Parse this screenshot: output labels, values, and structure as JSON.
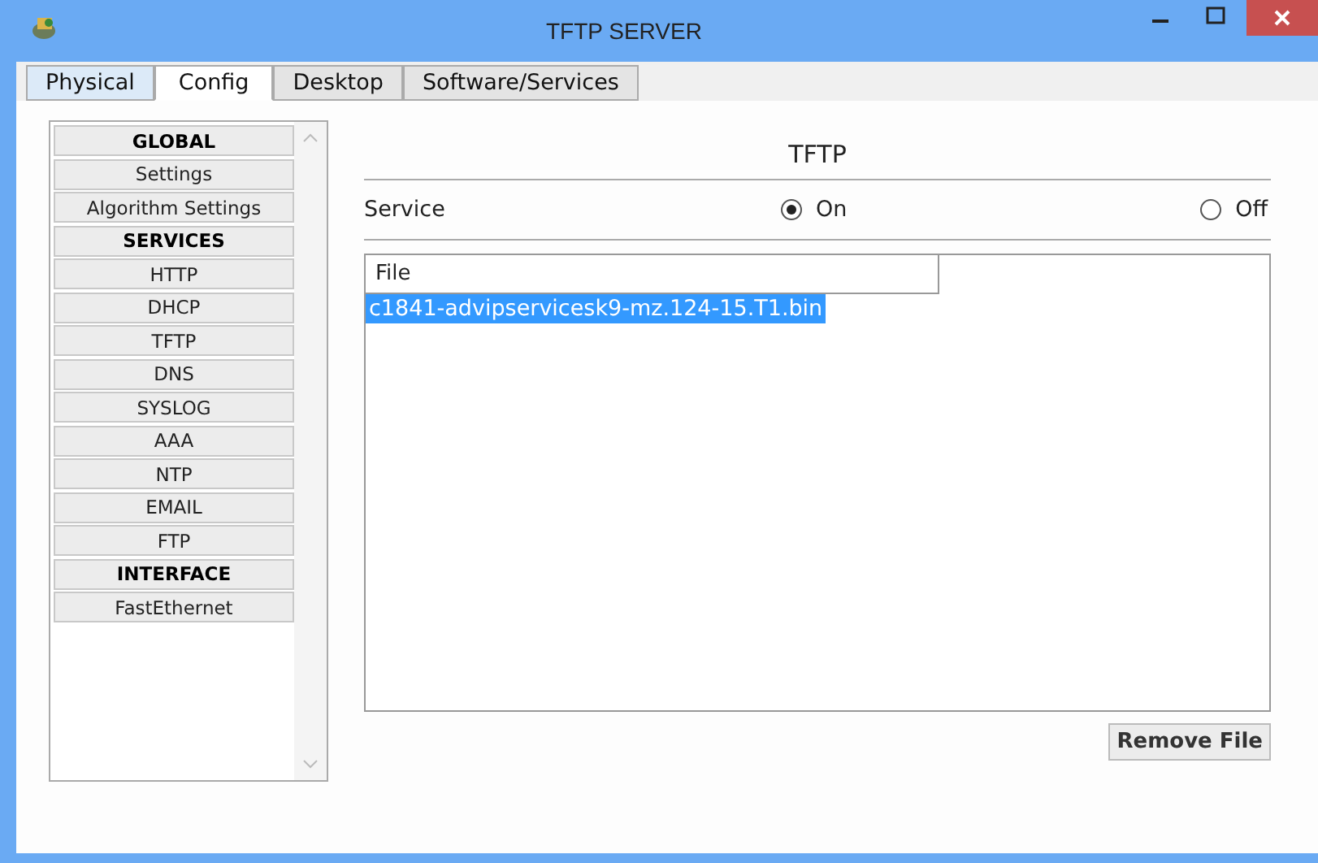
{
  "window": {
    "title": "TFTP SERVER"
  },
  "tabs": [
    {
      "label": "Physical",
      "selected": false
    },
    {
      "label": "Config",
      "selected": true
    },
    {
      "label": "Desktop",
      "selected": false
    },
    {
      "label": "Software/Services",
      "selected": false
    }
  ],
  "sidebar": {
    "items": [
      {
        "label": "GLOBAL",
        "kind": "header",
        "selected": false
      },
      {
        "label": "Settings",
        "kind": "item",
        "selected": false
      },
      {
        "label": "Algorithm Settings",
        "kind": "item",
        "selected": false
      },
      {
        "label": "SERVICES",
        "kind": "header",
        "selected": false
      },
      {
        "label": "HTTP",
        "kind": "item",
        "selected": false
      },
      {
        "label": "DHCP",
        "kind": "item",
        "selected": false
      },
      {
        "label": "TFTP",
        "kind": "item",
        "selected": false
      },
      {
        "label": "DNS",
        "kind": "item",
        "selected": false
      },
      {
        "label": "SYSLOG",
        "kind": "item",
        "selected": false
      },
      {
        "label": "AAA",
        "kind": "item",
        "selected": false
      },
      {
        "label": "NTP",
        "kind": "item",
        "selected": false
      },
      {
        "label": "EMAIL",
        "kind": "item",
        "selected": false
      },
      {
        "label": "FTP",
        "kind": "item",
        "selected": false
      },
      {
        "label": "INTERFACE",
        "kind": "header",
        "selected": false
      },
      {
        "label": "FastEthernet",
        "kind": "item",
        "selected": false
      }
    ]
  },
  "panel": {
    "title": "TFTP",
    "service": {
      "label": "Service",
      "options": [
        {
          "label": "On",
          "selected": true
        },
        {
          "label": "Off",
          "selected": false
        }
      ]
    },
    "table": {
      "columns": [
        "File"
      ],
      "rows": [
        {
          "cells": [
            "c1841-advipservicesk9-mz.124-15.T1.bin"
          ],
          "selected": true
        }
      ]
    },
    "buttons": [
      "Remove File"
    ]
  }
}
